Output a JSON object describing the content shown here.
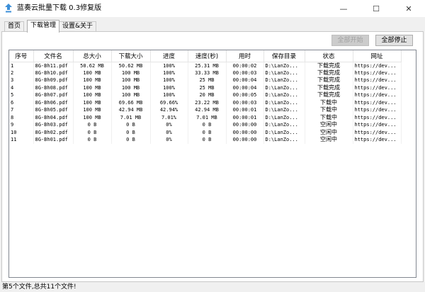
{
  "window": {
    "title": "蓝奏云批量下载 0.3修复版",
    "minimize_glyph": "—",
    "maximize_glyph": "☐",
    "close_glyph": "✕"
  },
  "tabs": [
    {
      "label": "首页",
      "active": false
    },
    {
      "label": "下载管理",
      "active": true
    },
    {
      "label": "设置&关于",
      "active": false
    }
  ],
  "toolbar": {
    "start_all_label": "全部开始",
    "start_all_enabled": false,
    "stop_all_label": "全部停止"
  },
  "table": {
    "columns": [
      "序号",
      "文件名",
      "总大小",
      "下载大小",
      "进度",
      "速度(秒)",
      "用时",
      "保存目录",
      "状态",
      "网址"
    ],
    "rows": [
      [
        "1",
        "8G-Bh11.pdf",
        "50.62 MB",
        "50.62 MB",
        "100%",
        "25.31 MB",
        "00:00:02",
        "D:\\LanZo...",
        "下载完成",
        "https://dev..."
      ],
      [
        "2",
        "8G-Bh10.pdf",
        "100 MB",
        "100 MB",
        "100%",
        "33.33 MB",
        "00:00:03",
        "D:\\LanZo...",
        "下载完成",
        "https://dev..."
      ],
      [
        "3",
        "8G-Bh09.pdf",
        "100 MB",
        "100 MB",
        "100%",
        "25 MB",
        "00:00:04",
        "D:\\LanZo...",
        "下载完成",
        "https://dev..."
      ],
      [
        "4",
        "8G-Bh08.pdf",
        "100 MB",
        "100 MB",
        "100%",
        "25 MB",
        "00:00:04",
        "D:\\LanZo...",
        "下载完成",
        "https://dev..."
      ],
      [
        "5",
        "8G-Bh07.pdf",
        "100 MB",
        "100 MB",
        "100%",
        "20 MB",
        "00:00:05",
        "D:\\LanZo...",
        "下载完成",
        "https://dev..."
      ],
      [
        "6",
        "8G-Bh06.pdf",
        "100 MB",
        "69.66 MB",
        "69.66%",
        "23.22 MB",
        "00:00:03",
        "D:\\LanZo...",
        "下载中",
        "https://dev..."
      ],
      [
        "7",
        "8G-Bh05.pdf",
        "100 MB",
        "42.94 MB",
        "42.94%",
        "42.94 MB",
        "00:00:01",
        "D:\\LanZo...",
        "下载中",
        "https://dev..."
      ],
      [
        "8",
        "8G-Bh04.pdf",
        "100 MB",
        "7.01 MB",
        "7.01%",
        "7.01 MB",
        "00:00:01",
        "D:\\LanZo...",
        "下载中",
        "https://dev..."
      ],
      [
        "9",
        "8G-Bh03.pdf",
        "0 B",
        "0 B",
        "0%",
        "0 B",
        "00:00:00",
        "D:\\LanZo...",
        "空闲中",
        "https://dev..."
      ],
      [
        "10",
        "8G-Bh02.pdf",
        "0 B",
        "0 B",
        "0%",
        "0 B",
        "00:00:00",
        "D:\\LanZo...",
        "空闲中",
        "https://dev..."
      ],
      [
        "11",
        "8G-Bh01.pdf",
        "0 B",
        "0 B",
        "0%",
        "0 B",
        "00:00:00",
        "D:\\LanZo...",
        "空闲中",
        "https://dev..."
      ]
    ]
  },
  "status": {
    "text": "第5个文件,总共11个文件!"
  },
  "colors": {
    "app_icon": "#3c8fd8",
    "disabled_text": "#a0a0a0"
  }
}
